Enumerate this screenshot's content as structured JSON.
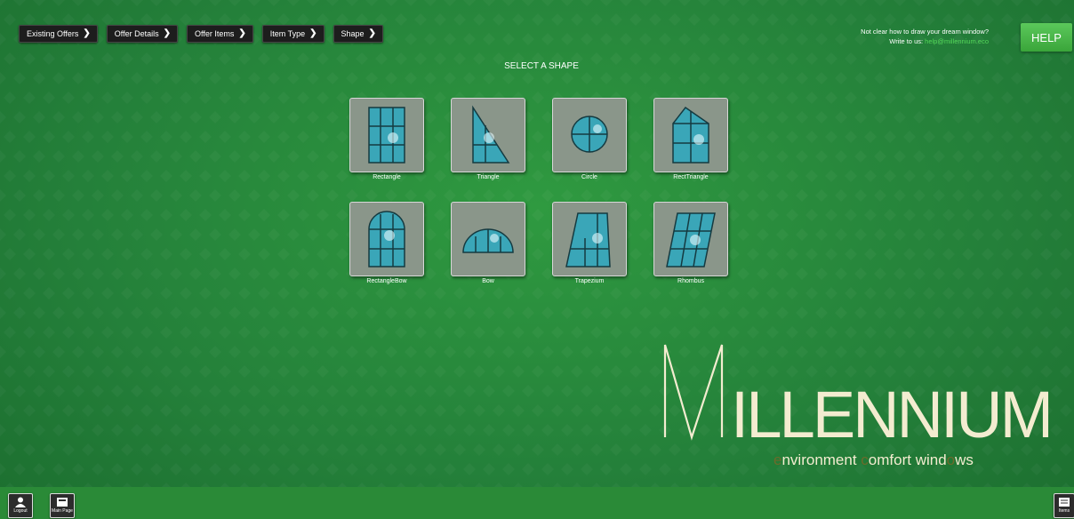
{
  "breadcrumb": [
    {
      "label": "Existing Offers"
    },
    {
      "label": "Offer Details"
    },
    {
      "label": "Offer Items"
    },
    {
      "label": "Item Type"
    },
    {
      "label": "Shape"
    }
  ],
  "help": {
    "line1": "Not clear how to draw your dream window?",
    "line2_prefix": "Write to us:",
    "email": "help@millennium.eco",
    "button_label": "HELP"
  },
  "page_title": "SELECT A SHAPE",
  "shapes": [
    {
      "label": "Rectangle",
      "icon": "rectangle-window-icon"
    },
    {
      "label": "Triangle",
      "icon": "triangle-window-icon"
    },
    {
      "label": "Circle",
      "icon": "circle-window-icon"
    },
    {
      "label": "RectTriangle",
      "icon": "recttriangle-window-icon"
    },
    {
      "label": "RectangleBow",
      "icon": "rectanglebow-window-icon"
    },
    {
      "label": "Bow",
      "icon": "bow-window-icon"
    },
    {
      "label": "Trapezium",
      "icon": "trapezium-window-icon"
    },
    {
      "label": "Rhombus",
      "icon": "rhombus-window-icon"
    }
  ],
  "logo": {
    "brand_letters": "ILLENNIUM",
    "tagline": {
      "p1": "e",
      "p2": "nvironment ",
      "p3": "c",
      "p4": "omfort wind",
      "p5": "o",
      "p6": "ws"
    }
  },
  "bottom": {
    "logout_label": "Logout",
    "main_page_label": "Main Page",
    "items_label": "Items"
  },
  "colors": {
    "background": "#2a8a3a",
    "help_button": "#4cb84c",
    "email": "#54d85a",
    "logo": "#f3ecd0"
  }
}
